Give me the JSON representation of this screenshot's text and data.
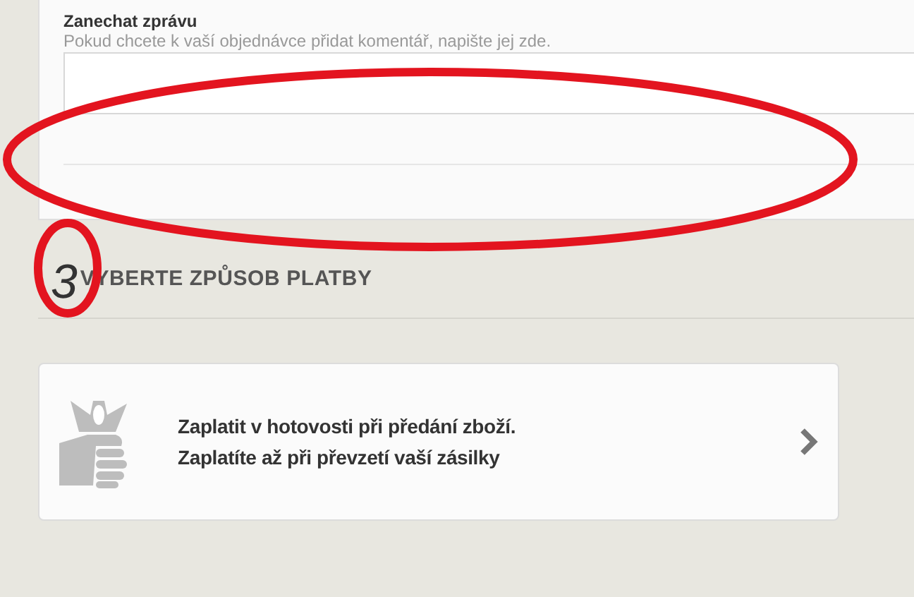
{
  "message": {
    "label": "Zanechat zprávu",
    "hint": "Pokud chcete k vaší objednávce přidat komentář, napište jej zde."
  },
  "payment_section": {
    "step": "3",
    "title": "VYBERTE ZPŮSOB PLATBY"
  },
  "payment_options": [
    {
      "kind": "cash",
      "title": "Zaplatit v hotovosti při předání zboží.",
      "subtitle": "Zaplatíte až při převzetí vaší zásilky"
    }
  ],
  "annotations": [
    {
      "kind": "ellipse"
    },
    {
      "kind": "ellipse"
    }
  ]
}
